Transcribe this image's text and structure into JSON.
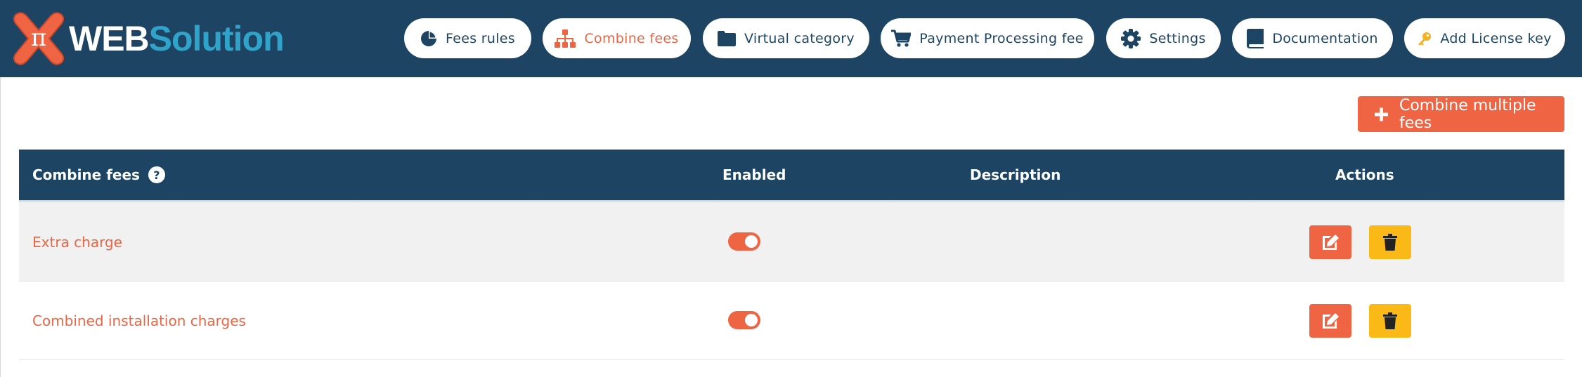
{
  "brand": {
    "prefix": "WEB",
    "suffix": "Solution",
    "mark_glyph": "π"
  },
  "nav": [
    {
      "label": "Fees rules",
      "icon": "pie-chart-icon",
      "active": false
    },
    {
      "label": "Combine fees",
      "icon": "sitemap-icon",
      "active": true
    },
    {
      "label": "Virtual category",
      "icon": "folder-icon",
      "active": false
    },
    {
      "label": "Payment Processing fee",
      "icon": "cart-icon",
      "active": false
    },
    {
      "label": "Settings",
      "icon": "gear-icon",
      "active": false
    },
    {
      "label": "Documentation",
      "icon": "book-icon",
      "active": false
    },
    {
      "label": "Add License key",
      "icon": "key-icon",
      "active": false
    }
  ],
  "actions": {
    "combine_label": "Combine multiple fees"
  },
  "table": {
    "headers": {
      "name": "Combine fees",
      "enabled": "Enabled",
      "description": "Description",
      "actions": "Actions"
    },
    "help_glyph": "?",
    "rows": [
      {
        "name": "Extra charge",
        "enabled": true,
        "description": ""
      },
      {
        "name": "Combined installation charges",
        "enabled": true,
        "description": ""
      }
    ]
  },
  "colors": {
    "navy": "#1d4563",
    "accent": "#ee6543",
    "delete": "#fbb917",
    "brand_blue": "#2fa3c9"
  }
}
